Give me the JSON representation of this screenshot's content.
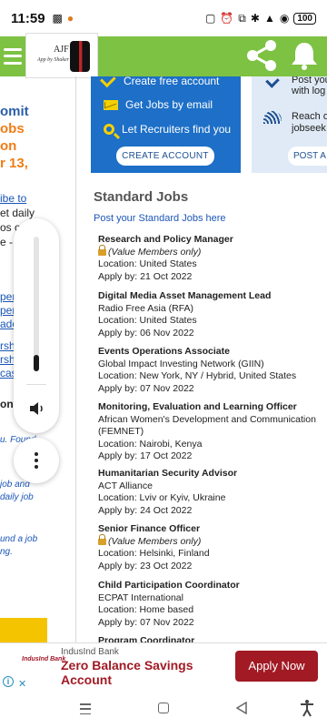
{
  "status": {
    "time": "11:59",
    "battery": "100"
  },
  "header": {
    "logo_text": "AJF",
    "logo_sub": "App by Shaker"
  },
  "left_panel": {
    "line1": "omit",
    "line2": "obs",
    "line3": "on",
    "line4": "r 13,",
    "subscribe_link": "ibe to",
    "text1": "et daily",
    "text2": "os or",
    "text3": "e -",
    "links": [
      "per",
      "per",
      "ado"
    ],
    "links2": [
      "rsh",
      "rsh",
      "cas"
    ],
    "bold": "on",
    "ital1": "u. Found",
    "ital2": "job and",
    "ital3": "daily job",
    "ital4": "und a job",
    "ital5": "ng."
  },
  "promo": {
    "items": [
      "Create free account",
      "Get Jobs by email",
      "Let Recruiters find you"
    ],
    "button": "CREATE ACCOUNT"
  },
  "promo2": {
    "line1": "Post you",
    "line2": "with log",
    "line3": "Reach o",
    "line4": "jobseek",
    "button": "POST A JO"
  },
  "standard_jobs": {
    "title": "Standard Jobs",
    "post_link": "Post your Standard Jobs here",
    "jobs": [
      {
        "title": "Research and Policy Manager",
        "org": "(Value Members only)",
        "location": "Location: United States",
        "apply": "Apply by: 21 Oct 2022"
      },
      {
        "title": "Digital Media Asset Management Lead",
        "org": "Radio Free Asia (RFA)",
        "location": "Location: United States",
        "apply": "Apply by: 06 Nov 2022"
      },
      {
        "title": "Events Operations Associate",
        "org": "Global Impact Investing Network (GIIN)",
        "location": "Location: New York, NY / Hybrid, United States",
        "apply": "Apply by: 07 Nov 2022"
      },
      {
        "title": "Monitoring, Evaluation and Learning Officer",
        "org": "African Women's Development and Communication",
        "org2": "(FEMNET)",
        "location": "Location: Nairobi, Kenya",
        "apply": "Apply by: 17 Oct 2022"
      },
      {
        "title": "Humanitarian Security Advisor",
        "org": "ACT Alliance",
        "location": "Location: Lviv or Kyiv, Ukraine",
        "apply": "Apply by: 24 Oct 2022"
      },
      {
        "title": "Senior Finance Officer",
        "org": "(Value Members only)",
        "location": "Location: Helsinki, Finland",
        "apply": "Apply by: 23 Oct 2022"
      },
      {
        "title": "Child Participation Coordinator",
        "org": "ECPAT International",
        "location": "Location: Home based",
        "apply": "Apply by: 07 Nov 2022"
      },
      {
        "title": "Program Coordinator"
      }
    ]
  },
  "volume": {
    "level": 0.12
  },
  "ad": {
    "logo": "IndusInd Bank",
    "brand": "IndusInd Bank",
    "headline": "Zero Balance Savings Account",
    "cta": "Apply Now"
  }
}
